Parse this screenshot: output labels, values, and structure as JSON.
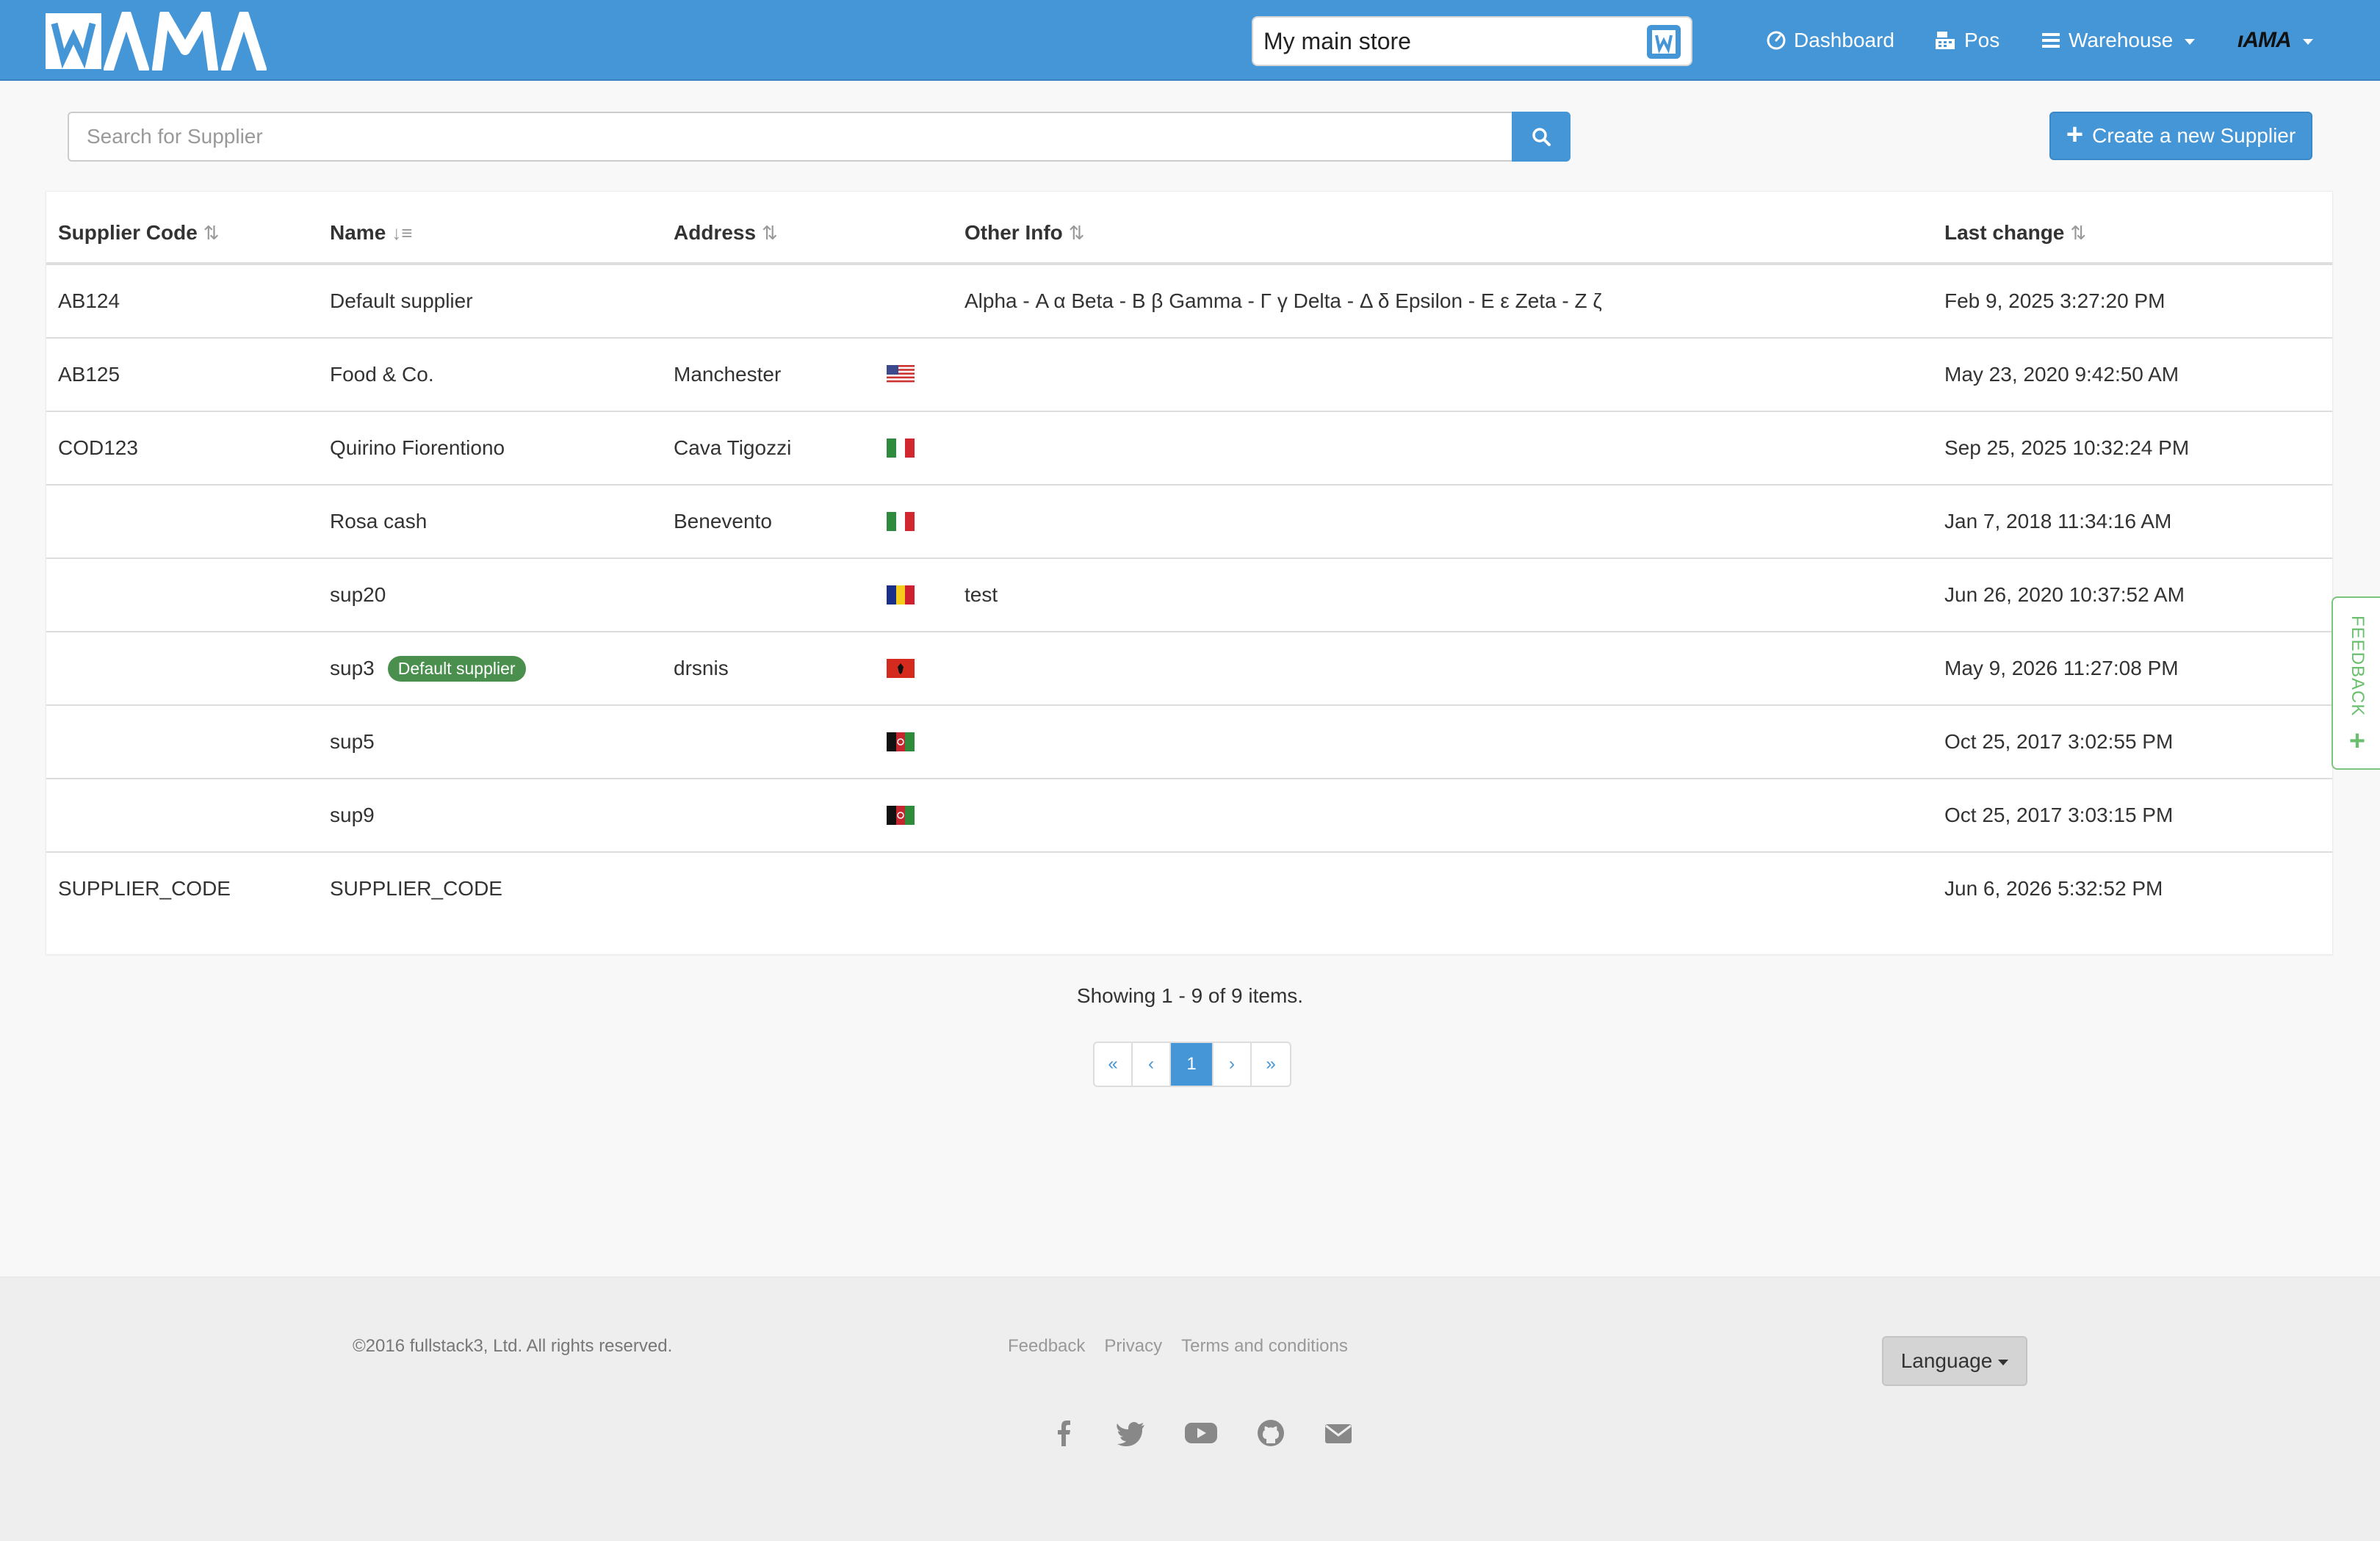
{
  "brand": {
    "logo_text": "WAMA"
  },
  "navbar": {
    "store": "My main store",
    "items": [
      {
        "label": "Dashboard",
        "icon": "dashboard-icon"
      },
      {
        "label": "Pos",
        "icon": "pos-icon"
      },
      {
        "label": "Warehouse",
        "icon": "menu-icon"
      }
    ],
    "account_logo_text": "AMA"
  },
  "toolbar": {
    "search_placeholder": "Search for Supplier",
    "create_label": "Create a new Supplier"
  },
  "table": {
    "columns": {
      "code": "Supplier Code",
      "name": "Name",
      "address": "Address",
      "other": "Other Info",
      "changed": "Last change"
    },
    "rows": [
      {
        "code": "AB124",
        "name": "Default supplier",
        "badge": "",
        "address": "",
        "flag": "",
        "other": "Alpha - Α α Beta - Β β Gamma - Γ γ Delta - Δ δ Epsilon - Ε ε Zeta - Ζ ζ",
        "changed": "Feb 9, 2025 3:27:20 PM"
      },
      {
        "code": "AB125",
        "name": "Food & Co.",
        "badge": "",
        "address": "Manchester",
        "flag": "us",
        "other": "",
        "changed": "May 23, 2020 9:42:50 AM"
      },
      {
        "code": "COD123",
        "name": "Quirino Fiorentiono",
        "badge": "",
        "address": "Cava Tigozzi",
        "flag": "it",
        "other": "",
        "changed": "Sep 25, 2025 10:32:24 PM"
      },
      {
        "code": "",
        "name": "Rosa cash",
        "badge": "",
        "address": "Benevento",
        "flag": "it",
        "other": "",
        "changed": "Jan 7, 2018 11:34:16 AM"
      },
      {
        "code": "",
        "name": "sup20",
        "badge": "",
        "address": "",
        "flag": "ro",
        "other": "test",
        "changed": "Jun 26, 2020 10:37:52 AM"
      },
      {
        "code": "",
        "name": "sup3",
        "badge": "Default supplier",
        "address": "drsnis",
        "flag": "al",
        "other": "",
        "changed": "May 9, 2026 11:27:08 PM"
      },
      {
        "code": "",
        "name": "sup5",
        "badge": "",
        "address": "",
        "flag": "af",
        "other": "",
        "changed": "Oct 25, 2017 3:02:55 PM"
      },
      {
        "code": "",
        "name": "sup9",
        "badge": "",
        "address": "",
        "flag": "af",
        "other": "",
        "changed": "Oct 25, 2017 3:03:15 PM"
      },
      {
        "code": "SUPPLIER_CODE",
        "name": "SUPPLIER_CODE",
        "badge": "",
        "address": "",
        "flag": "",
        "other": "",
        "changed": "Jun 6, 2026 5:32:52 PM"
      }
    ]
  },
  "pagination": {
    "summary": "Showing 1 - 9 of 9 items.",
    "first": "«",
    "prev": "‹",
    "current": "1",
    "next": "›",
    "last": "»"
  },
  "feedback_tab": {
    "label": "FEEDBACK",
    "plus": "+"
  },
  "footer": {
    "copyright": "©2016 fullstack3, Ltd. All rights reserved.",
    "links": [
      "Feedback",
      "Privacy",
      "Terms and conditions"
    ],
    "language_label": "Language",
    "socials": [
      "facebook-icon",
      "twitter-icon",
      "youtube-icon",
      "github-icon",
      "envelope-icon"
    ]
  },
  "colors": {
    "primary": "#4596d7",
    "badge_green": "#4a8f4e",
    "feedback_green": "#6abf6e"
  }
}
